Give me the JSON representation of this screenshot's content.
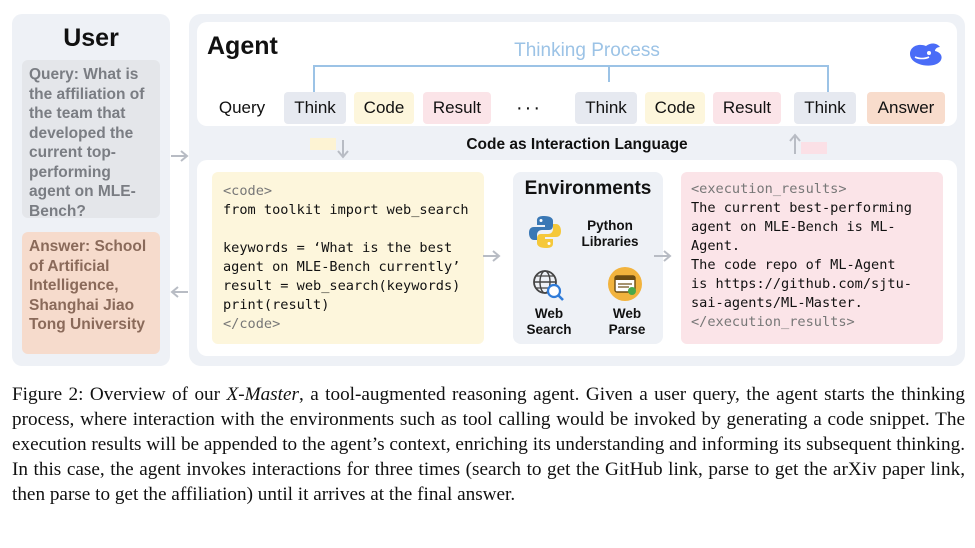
{
  "user": {
    "title": "User",
    "query": "Query: What is the affiliation of the team that developed the current top-performing agent on MLE-Bench?",
    "answer": "Answer: School of Artificial Intelligence, Shanghai Jiao Tong University"
  },
  "agent": {
    "title": "Agent",
    "thinking_process": "Thinking Process",
    "logo_icon": "whale-logo-icon",
    "sequence": [
      "Query",
      "Think",
      "Code",
      "Result",
      "···",
      "Think",
      "Code",
      "Result",
      "Think",
      "Answer"
    ],
    "interaction_label": "Code as Interaction Language"
  },
  "code_block": {
    "lines": [
      "<code>",
      "from toolkit import web_search",
      "",
      "keywords = ‘What is the best",
      "agent on MLE-Bench currently’",
      "result = web_search(keywords)",
      "print(result)",
      "</code>"
    ]
  },
  "environments": {
    "title": "Environments",
    "python_label": "Python Libraries",
    "web_search_label": "Web Search",
    "web_parse_label": "Web Parse"
  },
  "execution_results": {
    "lines": [
      "<execution_results>",
      "The current best-performing",
      "agent on MLE-Bench is ML-",
      "Agent.",
      "The code repo of ML-Agent",
      "is https://github.com/sjtu-",
      "sai-agents/ML-Master.",
      "</execution_results>"
    ]
  },
  "caption": {
    "prefix": "Figure 2: Overview of our ",
    "emph": "X-Master",
    "rest": ", a tool-augmented reasoning agent. Given a user query, the agent starts the thinking process, where interaction with the environments such as tool calling would be invoked by generating a code snippet. The execution results will be appended to the agent’s context, enriching its understanding and informing its subsequent thinking. In this case, the agent invokes interactions for three times (search to get the GitHub link, parse to get the arXiv paper link, then parse to get the affiliation) until it arrives at the final answer."
  },
  "colors": {
    "think": "#e6e9f0",
    "code": "#fdf6dc",
    "result": "#fbe4e8",
    "answer": "#f8dccc",
    "thinking_label": "#9cc3e6",
    "panel": "#eef1f6"
  }
}
